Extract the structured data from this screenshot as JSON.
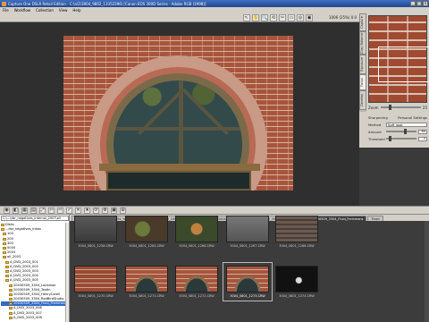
{
  "window": {
    "title": "Capture One DSLR Retail Edition - C:\\a\\2\\3004_9802_13352396\\ [Canon EOS 300D Series - Adobe RGB (1998)]"
  },
  "menu": [
    "File",
    "Workflow",
    "Collection",
    "View",
    "Help"
  ],
  "toolbar": {
    "tools": [
      "↖",
      "✋",
      "🔍",
      "⟲",
      "✂",
      "▭",
      "◎",
      "▣"
    ],
    "zoom_readout": "1006  (25%)  0.0"
  },
  "right_panel": {
    "tabs": [
      "Capture",
      "Gray Balance",
      "Exposure",
      "Focus",
      "Develop"
    ],
    "zoom_label": "Zoom",
    "zoom_value": 25,
    "sharpening_title": "Sharpening",
    "sharpening_settings_label": "Personal Settings",
    "method_label": "Method",
    "method_value": "Soft look",
    "amount_label": "Amount",
    "amount_value": "80",
    "threshold_label": "Threshold",
    "threshold_value": "2"
  },
  "bottom_toolbar": [
    "◉",
    "◧",
    "▦",
    "▤",
    "⤢",
    "⇦",
    "⇨",
    "✓",
    "✕",
    "★",
    "⟳",
    "⚙",
    "▣",
    "⊞"
  ],
  "folder_tree": {
    "path": "C:\\...\\dsr_negatives_internal_2007\\all",
    "items": [
      {
        "label": "Disks",
        "selected": false
      },
      {
        "label": "...dsr_negatives_inbox",
        "selected": false
      },
      {
        "label": "100",
        "selected": false
      },
      {
        "label": "200",
        "selected": false
      },
      {
        "label": "300",
        "selected": false
      },
      {
        "label": "5000",
        "selected": false
      },
      {
        "label": "2003",
        "selected": false
      },
      {
        "label": "all_2003",
        "selected": false
      },
      {
        "label": "A_DVD_2003_001",
        "selected": false
      },
      {
        "label": "A_DVD_2003_002",
        "selected": false
      },
      {
        "label": "A_DVD_2003_003",
        "selected": false
      },
      {
        "label": "A_DVD_2003_004",
        "selected": false
      },
      {
        "label": "A_DVD_2003_005",
        "selected": false
      },
      {
        "label": "20030509_3304_Lockdoor",
        "selected": false
      },
      {
        "label": "20030509_3304_Textln",
        "selected": false
      },
      {
        "label": "20030509_3304_HenryCorell",
        "selected": false
      },
      {
        "label": "20030509_3304_RedBirdStudio",
        "selected": false
      },
      {
        "label": "20030509_3304_Fluid_Freinmans",
        "selected": true
      },
      {
        "label": "A_DVD_2003_006",
        "selected": false
      },
      {
        "label": "A_DVD_2003_007",
        "selected": false
      },
      {
        "label": "A_DVD_2003_008",
        "selected": false
      }
    ]
  },
  "browser_tabs": [
    {
      "label": "Capture",
      "active": false
    },
    {
      "label": "20030509_3004_YosemitePlans",
      "active": false
    },
    {
      "label": "20030509_1004_LoDaloc",
      "active": false
    },
    {
      "label": "20030509_1004_HenryCorell",
      "active": false
    },
    {
      "label": "20030509_3004_RedBirdStudio",
      "active": false
    },
    {
      "label": "20030509_3304_Fluid_Freinmans",
      "active": true
    },
    {
      "label": "Trash",
      "active": false
    }
  ],
  "thumbnails": [
    {
      "caption": "3004_0801_1258.CRW",
      "style": "img-wall",
      "selected": false
    },
    {
      "caption": "3004_0801_1264.CRW",
      "style": "img-green",
      "selected": false
    },
    {
      "caption": "3004_0801_1266.CRW",
      "style": "img-flower",
      "selected": false
    },
    {
      "caption": "3004_0801_1267.CRW",
      "style": "img-grey",
      "selected": false
    },
    {
      "caption": "3004_0801_1268.CRW",
      "style": "img-wood",
      "selected": false
    },
    {
      "caption": "3004_0801_1270.CRW",
      "style": "img-brick",
      "selected": false
    },
    {
      "caption": "3004_0801_1271.CRW",
      "style": "img-arch",
      "selected": false
    },
    {
      "caption": "3004_0801_1272.CRW",
      "style": "img-arch",
      "selected": false
    },
    {
      "caption": "3004_0801_1273.CRW",
      "style": "img-arch",
      "selected": true
    },
    {
      "caption": "3004_0801_1274.CRW",
      "style": "img-dark",
      "selected": false
    }
  ]
}
